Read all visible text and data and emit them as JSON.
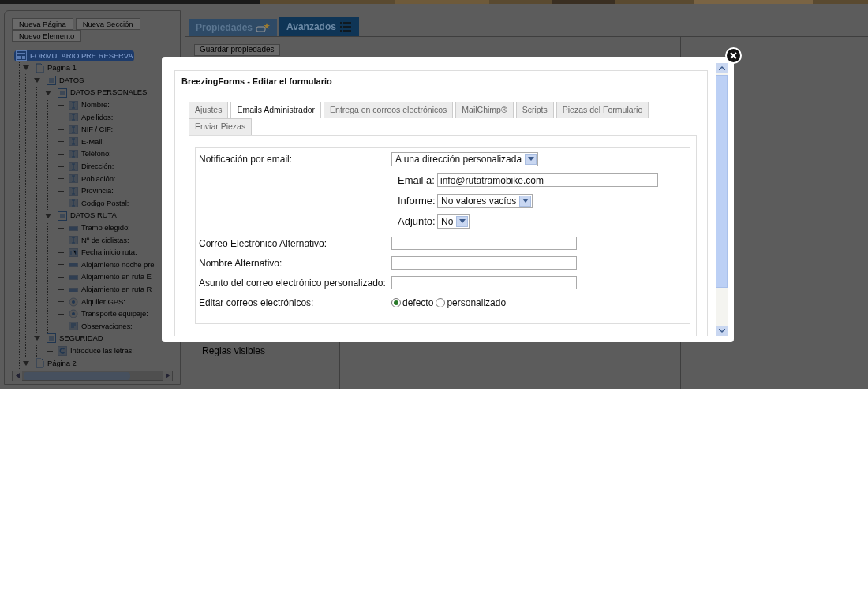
{
  "toolbar": {
    "buttons": [
      "Nueva Página",
      "Nueva Sección",
      "Nuevo Elemento"
    ]
  },
  "tree": {
    "label": "FORMULARIO PRE RESERVA",
    "kind": "form",
    "selected": true,
    "children": [
      {
        "label": "Página 1",
        "kind": "page",
        "selected": false,
        "expanded": true,
        "children": [
          {
            "label": "DATOS",
            "kind": "section",
            "selected": false,
            "expanded": true,
            "children": [
              {
                "label": "DATOS PERSONALES",
                "kind": "section",
                "selected": false,
                "expanded": true,
                "children": [
                  {
                    "label": "Nombre:",
                    "kind": "text",
                    "selected": false
                  },
                  {
                    "label": "Apellidos:",
                    "kind": "text",
                    "selected": false
                  },
                  {
                    "label": "NIF / CIF:",
                    "kind": "text",
                    "selected": false
                  },
                  {
                    "label": "E-Mail:",
                    "kind": "text",
                    "selected": false
                  },
                  {
                    "label": "Teléfono:",
                    "kind": "text",
                    "selected": false
                  },
                  {
                    "label": "Dirección:",
                    "kind": "text",
                    "selected": false
                  },
                  {
                    "label": "Población:",
                    "kind": "text",
                    "selected": false
                  },
                  {
                    "label": "Provincia:",
                    "kind": "text",
                    "selected": false
                  },
                  {
                    "label": "Codigo Postal:",
                    "kind": "text",
                    "selected": false
                  }
                ]
              },
              {
                "label": "DATOS RUTA",
                "kind": "section",
                "selected": false,
                "expanded": true,
                "children": [
                  {
                    "label": "Tramo elegido:",
                    "kind": "select",
                    "selected": false
                  },
                  {
                    "label": "Nº de ciclistas:",
                    "kind": "text",
                    "selected": false
                  },
                  {
                    "label": "Fecha inicio ruta:",
                    "kind": "date",
                    "selected": false
                  },
                  {
                    "label": "Alojamiento noche pre",
                    "kind": "select",
                    "selected": false
                  },
                  {
                    "label": "Alojamiento en ruta E",
                    "kind": "select",
                    "selected": false
                  },
                  {
                    "label": "Alojamiento en ruta R",
                    "kind": "select",
                    "selected": false
                  },
                  {
                    "label": "Alquiler GPS:",
                    "kind": "radio",
                    "selected": false
                  },
                  {
                    "label": "Transporte equipaje:",
                    "kind": "radio",
                    "selected": false
                  },
                  {
                    "label": "Observaciones:",
                    "kind": "textarea",
                    "selected": false
                  }
                ]
              }
            ]
          },
          {
            "label": "SEGURIDAD",
            "kind": "section",
            "selected": false,
            "expanded": true,
            "children": [
              {
                "label": "Introduce las letras:",
                "kind": "captcha",
                "selected": false
              }
            ]
          }
        ]
      },
      {
        "label": "Página 2",
        "kind": "page",
        "selected": false,
        "expanded": true
      }
    ]
  },
  "main_tabs": [
    {
      "label": "Propiedades",
      "selected": false
    },
    {
      "label": "Avanzados",
      "selected": true
    }
  ],
  "save_button": "Guardar propiedades",
  "rules_label": "Reglas visibles",
  "dialog": {
    "title": "BreezingForms - Editar el formulario",
    "tabs": [
      {
        "label": "Ajustes",
        "selected": false
      },
      {
        "label": "Emails Administrador",
        "selected": true
      },
      {
        "label": "Entrega en correos electrónicos",
        "selected": false
      },
      {
        "label": "MailChimp®",
        "selected": false
      },
      {
        "label": "Scripts",
        "selected": false
      },
      {
        "label": "Piezas del Formulario",
        "selected": false
      },
      {
        "label": "Enviar Piezas",
        "selected": false
      }
    ],
    "notification": {
      "label": "Notificación por email:",
      "value": "A una dirección personalizada"
    },
    "sub_fields": [
      {
        "kind": "input",
        "label": "Email a:",
        "value": "info@rutatramobike.com"
      },
      {
        "kind": "select",
        "label": "Informe:",
        "value": "No valores vacíos"
      },
      {
        "kind": "select",
        "label": "Adjunto:",
        "value": "No"
      }
    ],
    "text_fields": [
      {
        "label": "Correo Electrónico Alternativo:"
      },
      {
        "label": "Nombre Alternativo:"
      },
      {
        "label": "Asunto del correo electrónico personalizado:"
      }
    ],
    "edit_emails": {
      "label": "Editar correos electrónicos:",
      "options": [
        {
          "label": "defecto",
          "selected": true
        },
        {
          "label": "personalizado",
          "selected": false
        }
      ]
    }
  }
}
